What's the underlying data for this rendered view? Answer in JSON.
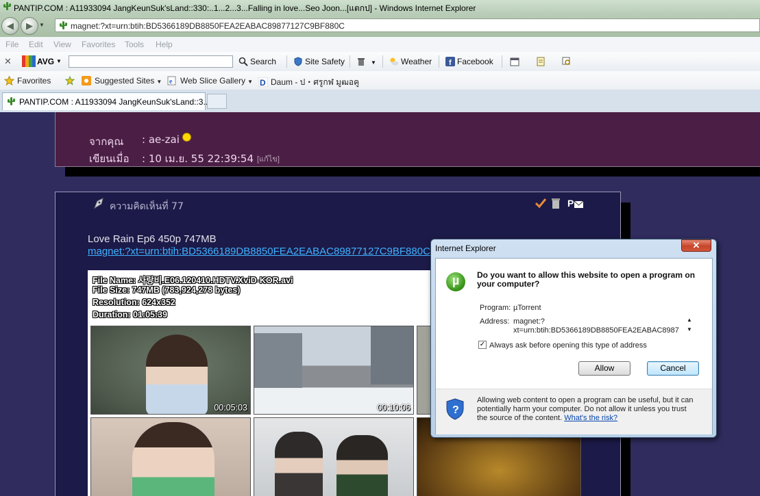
{
  "window": {
    "title": "PANTIP.COM : A11933094 JangKeunSuk'sLand::330:..1...2...3...Falling in love...Seo Joon...[แตกป] - Windows Internet Explorer"
  },
  "address": {
    "url": "magnet:?xt=urn:btih:BD5366189DB8850FEA2EABAC89877127C9BF880C"
  },
  "menu": [
    "File",
    "Edit",
    "View",
    "Favorites",
    "Tools",
    "Help"
  ],
  "avg_toolbar": {
    "brand": "AVG",
    "search_value": "",
    "search_label": "Search",
    "site_safety": "Site Safety",
    "weather": "Weather",
    "facebook": "Facebook"
  },
  "favorites_bar": {
    "favorites": "Favorites",
    "suggested": "Suggested Sites",
    "web_slice": "Web Slice Gallery",
    "daum": "Daum - ป・ศรูกฬ มูฒอคู"
  },
  "tab": {
    "label": "PANTIP.COM : A11933094 JangKeunSuk'sLand::3..."
  },
  "post_top": {
    "from_label": "จากคุณ",
    "from_value": ": ae-zai",
    "posted_label": "เขียนเมื่อ",
    "posted_value": ": 10 เม.ย. 55 22:39:54",
    "edit": "[แก้ไข]"
  },
  "comment": {
    "header": "ความคิดเห็นที่ 77",
    "title": "Love Rain Ep6 450p 747MB",
    "magnet": "magnet:?xt=urn:btih:BD5366189DB8850FEA2EABAC89877127C9BF880C",
    "file_info": [
      "File Name: 사랑비.E06.120410.HDTV.XviD-KOR.avi",
      "File Size: 747MB (783,924,278 bytes)",
      "Resolution: 624x352",
      "Duration: 01:05:39"
    ],
    "timestamps": [
      "00:05:03",
      "00:10:06"
    ]
  },
  "dialog": {
    "title": "Internet Explorer",
    "close": "✕",
    "question": "Do you want to allow this website to open a program on your computer?",
    "program_label": "Program:",
    "program_value": "µTorrent",
    "address_label": "Address:",
    "address_line1": "magnet:?",
    "address_line2": "xt=urn:btih:BD5366189DB8850FEA2EABAC8987",
    "always_ask": "Always ask before opening this type of address",
    "allow": "Allow",
    "cancel": "Cancel",
    "warning": "Allowing web content to open a program can be useful, but it can potentially harm your computer. Do not allow it unless you trust the source of the content.",
    "risk_link": "What's the risk?"
  }
}
